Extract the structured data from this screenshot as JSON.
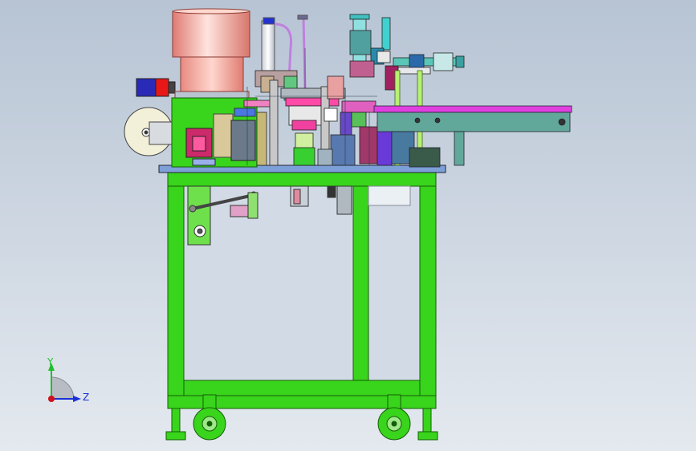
{
  "triad": {
    "y_label": "Y",
    "z_label": "Z",
    "y_color": "#1fbf2a",
    "z_color": "#1830d8",
    "origin_color": "#d0101e"
  },
  "colors": {
    "background_top": "#b9c6d6",
    "background_bottom": "#e3e8ee",
    "frame_green": "#39d41c",
    "frame_edge": "#155e08",
    "bowl_pink": "#f4a8a0",
    "conveyor_magenta": "#e040e0",
    "machine_teal": "#62a89a",
    "lime": "#b8f070",
    "purple": "#7a4ad8",
    "red_accent": "#e0142a"
  }
}
